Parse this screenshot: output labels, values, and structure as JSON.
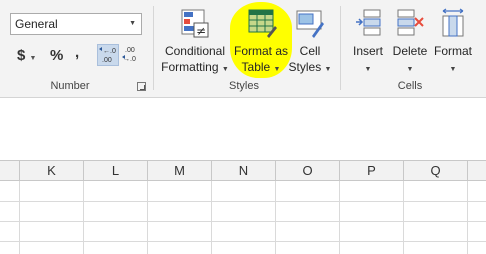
{
  "number_group": {
    "format_value": "General",
    "currency_symbol": "$",
    "percent_symbol": "%",
    "comma_symbol": ",",
    "label": "Number"
  },
  "styles_group": {
    "conditional_line1": "Conditional",
    "conditional_line2": "Formatting",
    "format_table_line1": "Format as",
    "format_table_line2": "Table",
    "cell_styles_line1": "Cell",
    "cell_styles_line2": "Styles",
    "label": "Styles"
  },
  "cells_group": {
    "insert_label": "Insert",
    "delete_label": "Delete",
    "format_label": "Format",
    "label": "Cells"
  },
  "columns": [
    "K",
    "L",
    "M",
    "N",
    "O",
    "P",
    "Q"
  ],
  "colors": {
    "highlight": "#ffff00",
    "accent_green": "#217346"
  }
}
